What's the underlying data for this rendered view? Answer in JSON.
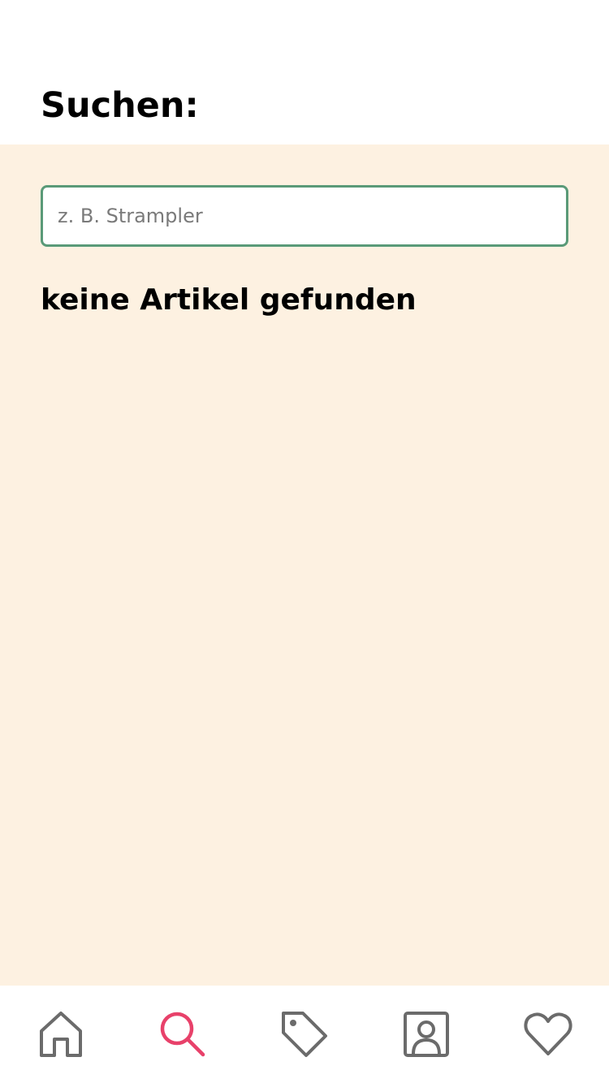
{
  "header": {
    "title": "Suchen:"
  },
  "search": {
    "placeholder": "z. B. Strampler",
    "value": ""
  },
  "results": {
    "empty_message": "keine Artikel gefunden"
  },
  "bottom_nav": {
    "items": [
      {
        "icon": "home-icon",
        "active": false
      },
      {
        "icon": "search-icon",
        "active": true
      },
      {
        "icon": "tag-icon",
        "active": false
      },
      {
        "icon": "profile-icon",
        "active": false
      },
      {
        "icon": "heart-icon",
        "active": false
      }
    ]
  },
  "colors": {
    "background": "#fdf1e1",
    "input_border": "#5a9a78",
    "active_icon": "#e8416a",
    "inactive_icon": "#6b6b6b"
  }
}
